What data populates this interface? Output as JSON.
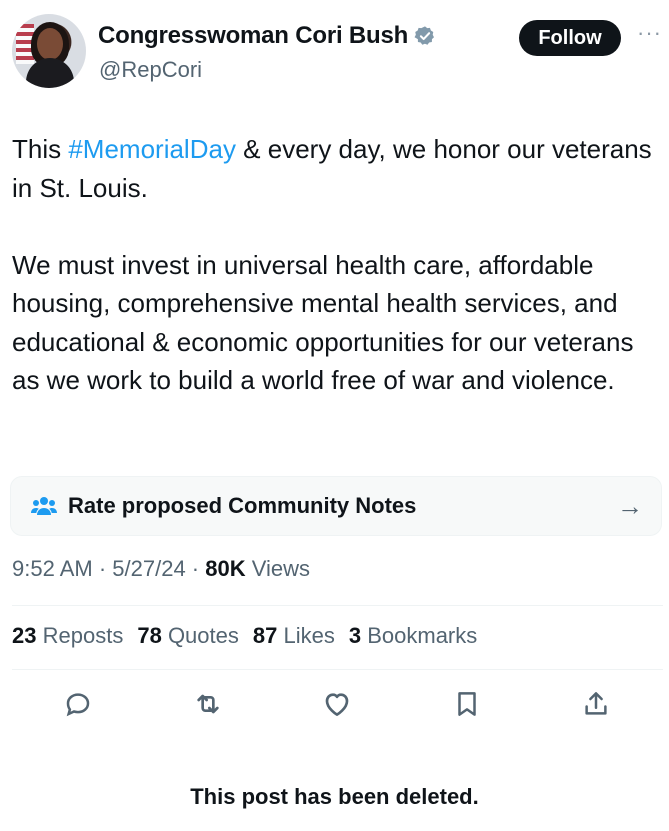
{
  "author": {
    "name": "Congresswoman Cori Bush",
    "handle": "@RepCori",
    "follow_label": "Follow",
    "more_label": "···"
  },
  "tweet": {
    "line1_before": "This ",
    "hashtag": "#MemorialDay",
    "line1_after": " & every day, we honor our veterans in St. Louis.",
    "paragraph2": "We must invest in universal health care, affordable housing, comprehensive mental health services, and educational & economic opportunities for our veterans as we work to build a world free of war and violence."
  },
  "community_notes": {
    "label": "Rate proposed Community Notes",
    "arrow": "→"
  },
  "meta": {
    "time": "9:52 AM",
    "sep1": " · ",
    "date": "5/27/24",
    "sep2": " · ",
    "views_count": "80K",
    "views_label": " Views"
  },
  "stats": {
    "reposts_count": "23",
    "reposts_label": "Reposts",
    "quotes_count": "78",
    "quotes_label": "Quotes",
    "likes_count": "87",
    "likes_label": "Likes",
    "bookmarks_count": "3",
    "bookmarks_label": "Bookmarks"
  },
  "actions": {
    "icons": [
      "reply-icon",
      "repost-icon",
      "like-icon",
      "bookmark-icon",
      "share-icon"
    ]
  },
  "footer": {
    "deleted_notice": "This post has been deleted."
  },
  "colors": {
    "text": "#0f1419",
    "secondary": "#536471",
    "link": "#1d9bf0",
    "verified_badge": "#829aab"
  }
}
